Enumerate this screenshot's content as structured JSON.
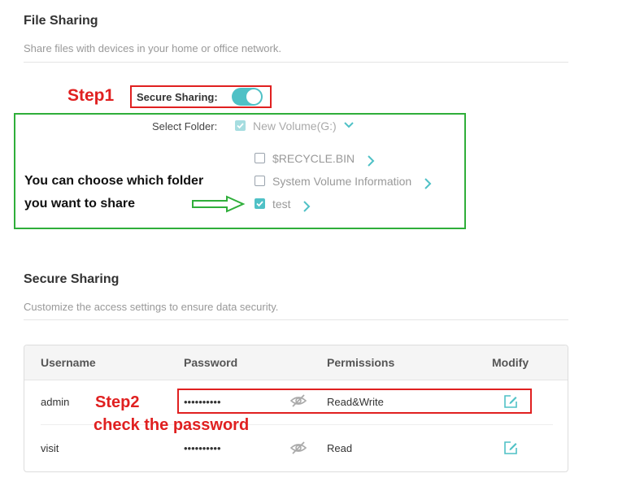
{
  "file_sharing": {
    "title": "File Sharing",
    "description": "Share files with devices in your home or office network.",
    "secure_sharing_label": "Secure Sharing:",
    "secure_sharing_on": true,
    "select_folder_label": "Select Folder:",
    "volume": "New Volume(G:)",
    "folders": [
      {
        "name": "$RECYCLE.BIN",
        "checked": false
      },
      {
        "name": "System Volume Information",
        "checked": false
      },
      {
        "name": "test",
        "checked": true
      }
    ]
  },
  "annotations": {
    "step1": "Step1",
    "choose_line1": "You can choose which folder",
    "choose_line2": "you want to share",
    "step2": "Step2",
    "check_password": "check the password"
  },
  "secure_sharing": {
    "title": "Secure Sharing",
    "description": "Customize the access settings to ensure data security.",
    "columns": [
      "Username",
      "Password",
      "Permissions",
      "Modify"
    ],
    "rows": [
      {
        "username": "admin",
        "password": "••••••••••",
        "permissions": "Read&Write"
      },
      {
        "username": "visit",
        "password": "••••••••••",
        "permissions": "Read"
      }
    ]
  },
  "colors": {
    "accent": "#4fc1c6",
    "annotation_red": "#e02020",
    "annotation_green": "#2fae3a"
  },
  "icons": [
    "chevron-down-icon",
    "chevron-right-icon",
    "eye-slash-icon",
    "edit-icon",
    "checkmark-icon",
    "arrow-right-icon"
  ]
}
